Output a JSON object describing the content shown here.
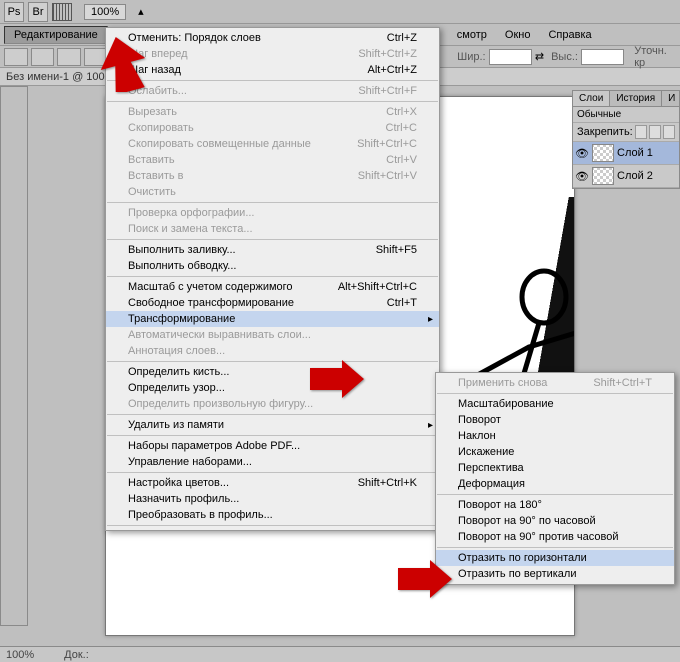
{
  "top": {
    "zoom": "100%"
  },
  "menubar": {
    "edit": "Редактирование",
    "view": "смотр",
    "window": "Окно",
    "help": "Справка"
  },
  "options": {
    "width_lbl": "Шир.:",
    "height_lbl": "Выс.:",
    "refine": "Уточн. кр"
  },
  "doc": {
    "title": "Без имени-1 @ 100"
  },
  "status": {
    "zoom": "100%",
    "doc": "Док.:"
  },
  "edit_menu": [
    {
      "label": "Отменить: Порядок слоев",
      "shortcut": "Ctrl+Z",
      "enabled": true
    },
    {
      "label": "Шаг вперед",
      "shortcut": "Shift+Ctrl+Z",
      "enabled": false
    },
    {
      "label": "Шаг назад",
      "shortcut": "Alt+Ctrl+Z",
      "enabled": true
    },
    {
      "sep": true
    },
    {
      "label": "Ослабить...",
      "shortcut": "Shift+Ctrl+F",
      "enabled": false
    },
    {
      "sep": true
    },
    {
      "label": "Вырезать",
      "shortcut": "Ctrl+X",
      "enabled": false
    },
    {
      "label": "Скопировать",
      "shortcut": "Ctrl+C",
      "enabled": false
    },
    {
      "label": "Скопировать совмещенные данные",
      "shortcut": "Shift+Ctrl+C",
      "enabled": false
    },
    {
      "label": "Вставить",
      "shortcut": "Ctrl+V",
      "enabled": false
    },
    {
      "label": "Вставить в",
      "shortcut": "Shift+Ctrl+V",
      "enabled": false
    },
    {
      "label": "Очистить",
      "shortcut": "",
      "enabled": false
    },
    {
      "sep": true
    },
    {
      "label": "Проверка орфографии...",
      "shortcut": "",
      "enabled": false
    },
    {
      "label": "Поиск и замена текста...",
      "shortcut": "",
      "enabled": false
    },
    {
      "sep": true
    },
    {
      "label": "Выполнить заливку...",
      "shortcut": "Shift+F5",
      "enabled": true
    },
    {
      "label": "Выполнить обводку...",
      "shortcut": "",
      "enabled": true
    },
    {
      "sep": true
    },
    {
      "label": "Масштаб с учетом содержимого",
      "shortcut": "Alt+Shift+Ctrl+C",
      "enabled": true
    },
    {
      "label": "Свободное трансформирование",
      "shortcut": "Ctrl+T",
      "enabled": true
    },
    {
      "label": "Трансформирование",
      "shortcut": "",
      "enabled": true,
      "hover": true,
      "submenu": true
    },
    {
      "label": "Автоматически выравнивать слои...",
      "shortcut": "",
      "enabled": false
    },
    {
      "label": "Аннотация слоев...",
      "shortcut": "",
      "enabled": false
    },
    {
      "sep": true
    },
    {
      "label": "Определить кисть...",
      "shortcut": "",
      "enabled": true
    },
    {
      "label": "Определить узор...",
      "shortcut": "",
      "enabled": true
    },
    {
      "label": "Определить произвольную фигуру...",
      "shortcut": "",
      "enabled": false
    },
    {
      "sep": true
    },
    {
      "label": "Удалить из памяти",
      "shortcut": "",
      "enabled": true,
      "submenu": true
    },
    {
      "sep": true
    },
    {
      "label": "Наборы параметров Adobe PDF...",
      "shortcut": "",
      "enabled": true
    },
    {
      "label": "Управление наборами...",
      "shortcut": "",
      "enabled": true
    },
    {
      "sep": true
    },
    {
      "label": "Настройка цветов...",
      "shortcut": "Shift+Ctrl+K",
      "enabled": true
    },
    {
      "label": "Назначить профиль...",
      "shortcut": "",
      "enabled": true
    },
    {
      "label": "Преобразовать в профиль...",
      "shortcut": "",
      "enabled": true
    },
    {
      "sep": true
    }
  ],
  "transform_menu": [
    {
      "label": "Применить снова",
      "shortcut": "Shift+Ctrl+T",
      "enabled": false
    },
    {
      "sep": true
    },
    {
      "label": "Масштабирование",
      "enabled": true
    },
    {
      "label": "Поворот",
      "enabled": true
    },
    {
      "label": "Наклон",
      "enabled": true
    },
    {
      "label": "Искажение",
      "enabled": true
    },
    {
      "label": "Перспектива",
      "enabled": true
    },
    {
      "label": "Деформация",
      "enabled": true
    },
    {
      "sep": true
    },
    {
      "label": "Поворот на 180°",
      "enabled": true
    },
    {
      "label": "Поворот на 90° по часовой",
      "enabled": true
    },
    {
      "label": "Поворот на 90° против часовой",
      "enabled": true
    },
    {
      "sep": true
    },
    {
      "label": "Отразить по горизонтали",
      "enabled": true,
      "hover": true
    },
    {
      "label": "Отразить по вертикали",
      "enabled": true
    }
  ],
  "layers": {
    "tab_layers": "Слои",
    "tab_history": "История",
    "tab_info": "И",
    "mode": "Обычные",
    "lock": "Закрепить:",
    "items": [
      {
        "name": "Слой 1",
        "active": true
      },
      {
        "name": "Слой 2",
        "active": false
      }
    ]
  }
}
